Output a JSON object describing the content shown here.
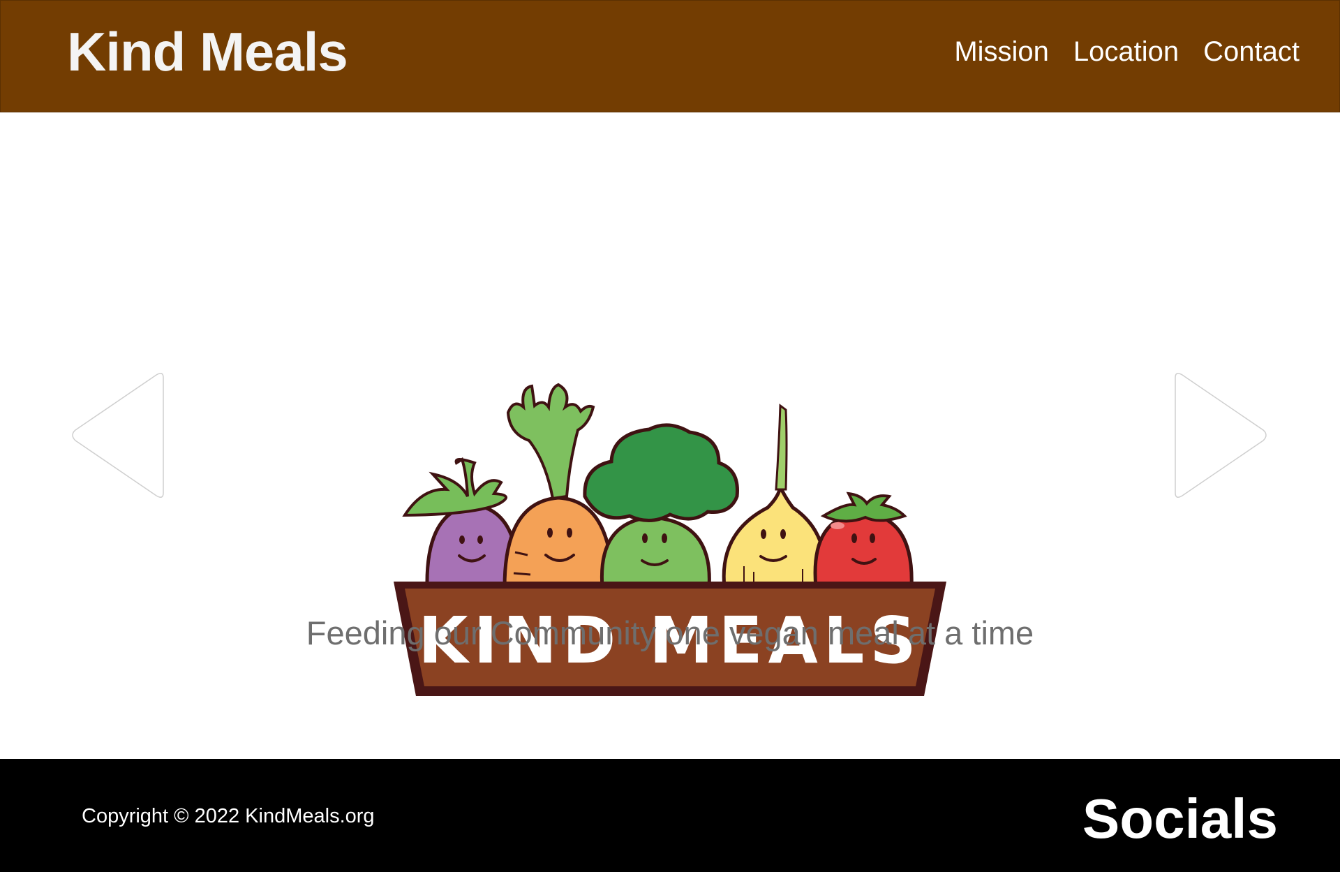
{
  "header": {
    "brand": "Kind Meals",
    "nav": [
      {
        "label": "Mission"
      },
      {
        "label": "Location"
      },
      {
        "label": "Contact"
      }
    ]
  },
  "hero": {
    "logo": {
      "text": "KIND MEALS",
      "vegetables": [
        "eggplant",
        "carrot",
        "broccoli",
        "onion",
        "tomato"
      ]
    },
    "tagline": "Feeding our Community one vegan meal at a time",
    "prev_icon": "triangle-left-icon",
    "next_icon": "triangle-right-icon"
  },
  "footer": {
    "copyright": "Copyright © 2022 KindMeals.org",
    "socials": "Socials"
  },
  "colors": {
    "header_bg": "#733d02",
    "footer_bg": "#000000",
    "tagline": "#6e6e6e",
    "logo_box": "#8b4222",
    "logo_outline": "#4a1616"
  }
}
